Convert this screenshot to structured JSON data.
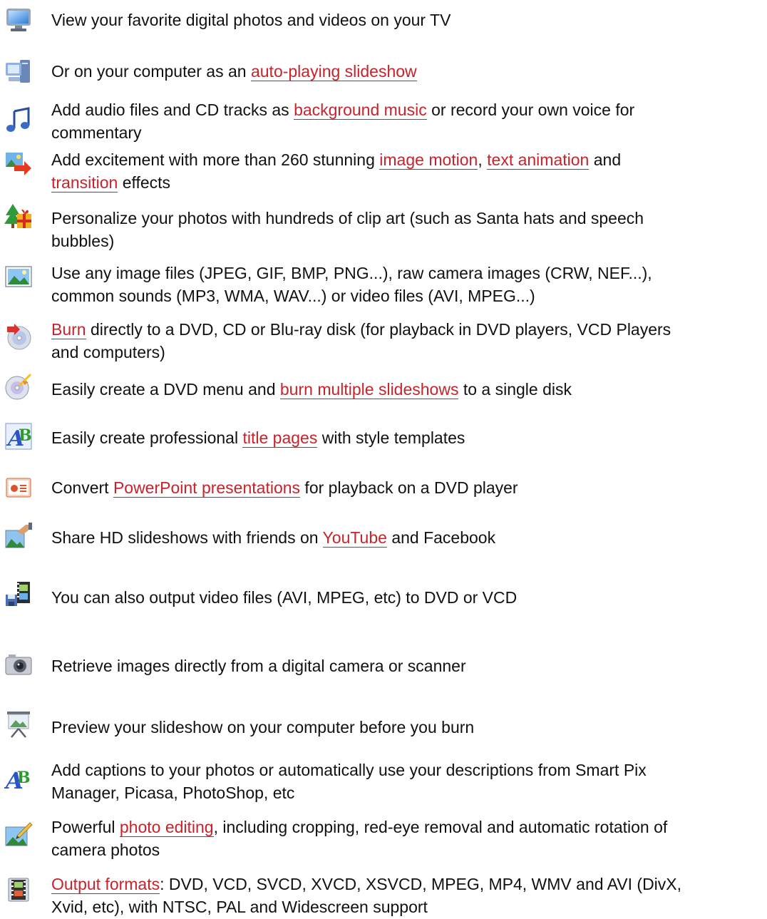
{
  "features": [
    {
      "icon": "tv-monitor-icon",
      "lines": [
        [
          {
            "t": "View your favorite digital photos and videos on your TV"
          }
        ]
      ]
    },
    {
      "icon": "computer-icon",
      "lines": [
        [
          {
            "t": "Or on your computer as an "
          },
          {
            "t": "auto-playing slideshow",
            "link": true
          }
        ]
      ]
    },
    {
      "icon": "music-note-icon",
      "lines": [
        [
          {
            "t": "Add audio files and CD tracks as "
          },
          {
            "t": "background music",
            "link": true
          },
          {
            "t": " or record your own voice for"
          }
        ],
        [
          {
            "t": "commentary"
          }
        ]
      ]
    },
    {
      "icon": "image-transition-icon",
      "lines": [
        [
          {
            "t": "Add excitement with more than 260 stunning "
          },
          {
            "t": "image motion",
            "link": true
          },
          {
            "t": ", "
          },
          {
            "t": "text animation",
            "link": true
          },
          {
            "t": " and"
          }
        ],
        [
          {
            "t": "transition",
            "link": true
          },
          {
            "t": " effects"
          }
        ]
      ]
    },
    {
      "icon": "clip-art-tree-gift-icon",
      "lines": [
        [
          {
            "t": "Personalize your photos with hundreds of clip art (such as Santa hats and speech"
          }
        ],
        [
          {
            "t": "bubbles)"
          }
        ]
      ]
    },
    {
      "icon": "landscape-image-icon",
      "lines": [
        [
          {
            "t": "Use any image files (JPEG, GIF, BMP, PNG...), raw camera images (CRW, NEF...),"
          }
        ],
        [
          {
            "t": "common sounds (MP3, WMA, WAV...) or video files (AVI, MPEG...)"
          }
        ]
      ]
    },
    {
      "icon": "burn-disc-icon",
      "lines": [
        [
          {
            "t": "Burn",
            "link": true
          },
          {
            "t": " directly to a DVD, CD or Blu-ray disk (for playback in DVD players, VCD Players"
          }
        ],
        [
          {
            "t": "and computers)"
          }
        ]
      ]
    },
    {
      "icon": "dvd-menu-disc-icon",
      "lines": [
        [
          {
            "t": "Easily create a DVD menu and "
          },
          {
            "t": "burn multiple slideshows",
            "link": true
          },
          {
            "t": " to a single disk"
          }
        ]
      ]
    },
    {
      "icon": "title-style-icon",
      "lines": [
        [
          {
            "t": "Easily create professional "
          },
          {
            "t": "title pages",
            "link": true
          },
          {
            "t": " with style templates"
          }
        ]
      ]
    },
    {
      "icon": "powerpoint-icon",
      "lines": [
        [
          {
            "t": "Convert "
          },
          {
            "t": "PowerPoint presentations",
            "link": true
          },
          {
            "t": " for playback on a DVD player"
          }
        ]
      ]
    },
    {
      "icon": "share-photo-icon",
      "lines": [
        [
          {
            "t": "Share HD slideshows with friends on "
          },
          {
            "t": "YouTube",
            "link": true
          },
          {
            "t": " and Facebook"
          }
        ]
      ]
    },
    {
      "icon": "video-film-save-icon",
      "lines": [
        [
          {
            "t": "You can also output video files (AVI, MPEG, etc) to DVD or VCD"
          }
        ]
      ]
    },
    {
      "icon": "camera-icon",
      "lines": [
        [
          {
            "t": "Retrieve images directly from a digital camera or scanner"
          }
        ]
      ]
    },
    {
      "icon": "projector-screen-icon",
      "lines": [
        [
          {
            "t": "Preview your slideshow on your computer before you burn"
          }
        ]
      ]
    },
    {
      "icon": "caption-text-icon",
      "lines": [
        [
          {
            "t": "Add captions to your photos or automatically use your descriptions from Smart Pix"
          }
        ],
        [
          {
            "t": "Manager, Picasa, PhotoShop, etc"
          }
        ]
      ]
    },
    {
      "icon": "photo-editing-icon",
      "lines": [
        [
          {
            "t": "Powerful "
          },
          {
            "t": "photo editing",
            "link": true
          },
          {
            "t": ", including cropping, red-eye removal and automatic rotation of"
          }
        ],
        [
          {
            "t": "camera photos"
          }
        ]
      ]
    },
    {
      "icon": "film-output-icon",
      "lines": [
        [
          {
            "t": "Output formats",
            "link": true
          },
          {
            "t": ": DVD, VCD, SVCD, XVCD, XSVCD, MPEG, MP4, WMV and AVI (DivX,"
          }
        ],
        [
          {
            "t": "Xvid, etc), with NTSC, PAL and Widescreen support"
          }
        ]
      ]
    }
  ]
}
